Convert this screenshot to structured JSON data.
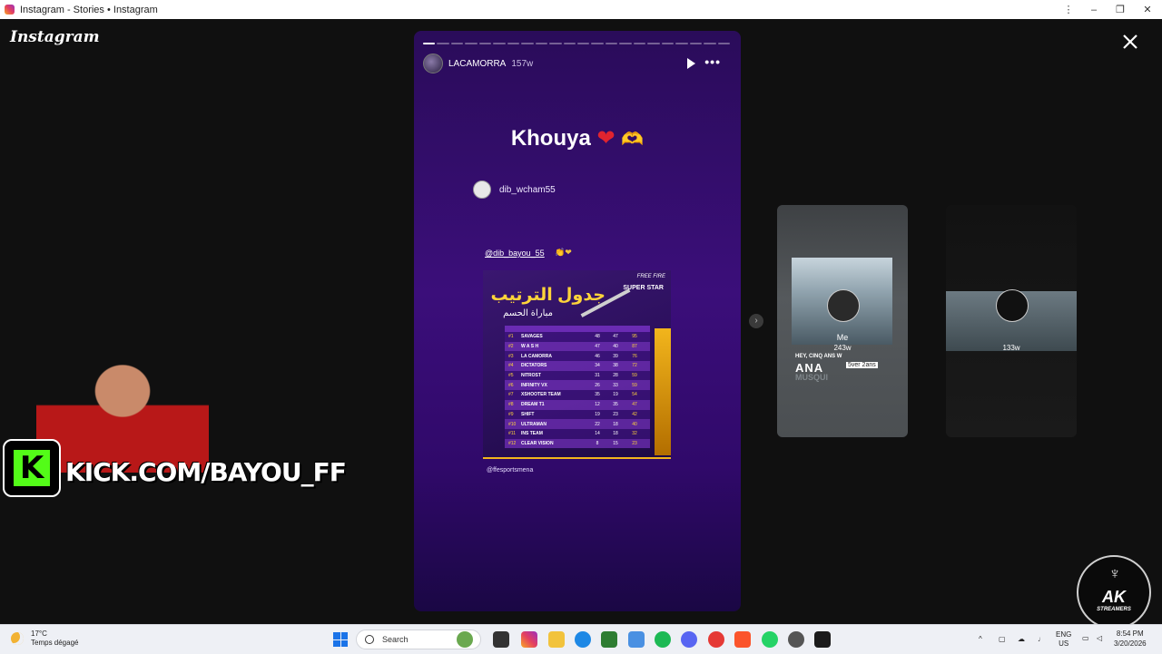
{
  "window": {
    "title": "Instagram - Stories • Instagram",
    "min": "–",
    "max": "❐",
    "close": "✕",
    "menu": "⋮"
  },
  "app": {
    "brand": "Instagram"
  },
  "story": {
    "username": "LACAMORRA",
    "age": "157w",
    "segments": 22,
    "current_segment": 1,
    "caption_text": "Khouya",
    "caption_heart": "❤",
    "caption_hands": "🫶",
    "repost": {
      "username": "dib_wcham55"
    },
    "mention": "@dib_bayou_55",
    "mention_emoji": "👏❤",
    "poster": {
      "title_ar": "جدول الترتيب",
      "subtitle_ar": "مباراة الحسم",
      "badge": "SUPER STAR",
      "logo": "FREE FIRE",
      "rows": [
        {
          "rank": "#1",
          "team": "SAVAGES",
          "a": "48",
          "b": "47",
          "c": "95"
        },
        {
          "rank": "#2",
          "team": "W A S H",
          "a": "47",
          "b": "40",
          "c": "87"
        },
        {
          "rank": "#3",
          "team": "LA CAMORRA",
          "a": "46",
          "b": "39",
          "c": "76"
        },
        {
          "rank": "#4",
          "team": "DICTATORS",
          "a": "34",
          "b": "38",
          "c": "72"
        },
        {
          "rank": "#5",
          "team": "NITROST",
          "a": "31",
          "b": "28",
          "c": "59"
        },
        {
          "rank": "#6",
          "team": "INFINITY VX",
          "a": "26",
          "b": "33",
          "c": "59"
        },
        {
          "rank": "#7",
          "team": "XSHOOTER TEAM",
          "a": "35",
          "b": "19",
          "c": "54"
        },
        {
          "rank": "#8",
          "team": "DREAM T1",
          "a": "12",
          "b": "35",
          "c": "47"
        },
        {
          "rank": "#9",
          "team": "SHIFT",
          "a": "19",
          "b": "23",
          "c": "42"
        },
        {
          "rank": "#10",
          "team": "ULTRAMAN",
          "a": "22",
          "b": "18",
          "c": "40"
        },
        {
          "rank": "#11",
          "team": "INS TEAM",
          "a": "14",
          "b": "18",
          "c": "32"
        },
        {
          "rank": "#12",
          "team": "CLEAR VISION",
          "a": "8",
          "b": "15",
          "c": "23"
        }
      ]
    },
    "source": "@ffesportsmena"
  },
  "previews": [
    {
      "name": "Me",
      "age": "243w",
      "text1": "HEY, CINQ ANS W",
      "text2": "ANA",
      "text3": "MUSQUI",
      "tag": "5ver 2ans"
    },
    {
      "age": "133w"
    }
  ],
  "overlay": {
    "kick_letter": "K",
    "kick_url": "KICK.COM/BAYOU_FF",
    "ak": "AK",
    "ak_sub": "STREAMERS"
  },
  "taskbar": {
    "temp": "17°C",
    "weather": "Temps dégagé",
    "search_placeholder": "Search",
    "lang": "ENG",
    "region": "US",
    "time": "8:54 PM",
    "date": "3/20/2026"
  },
  "colors": {
    "kick_green": "#53fc18",
    "story_purple": "#3b0e7a",
    "accent_gold": "#f2b51c"
  }
}
